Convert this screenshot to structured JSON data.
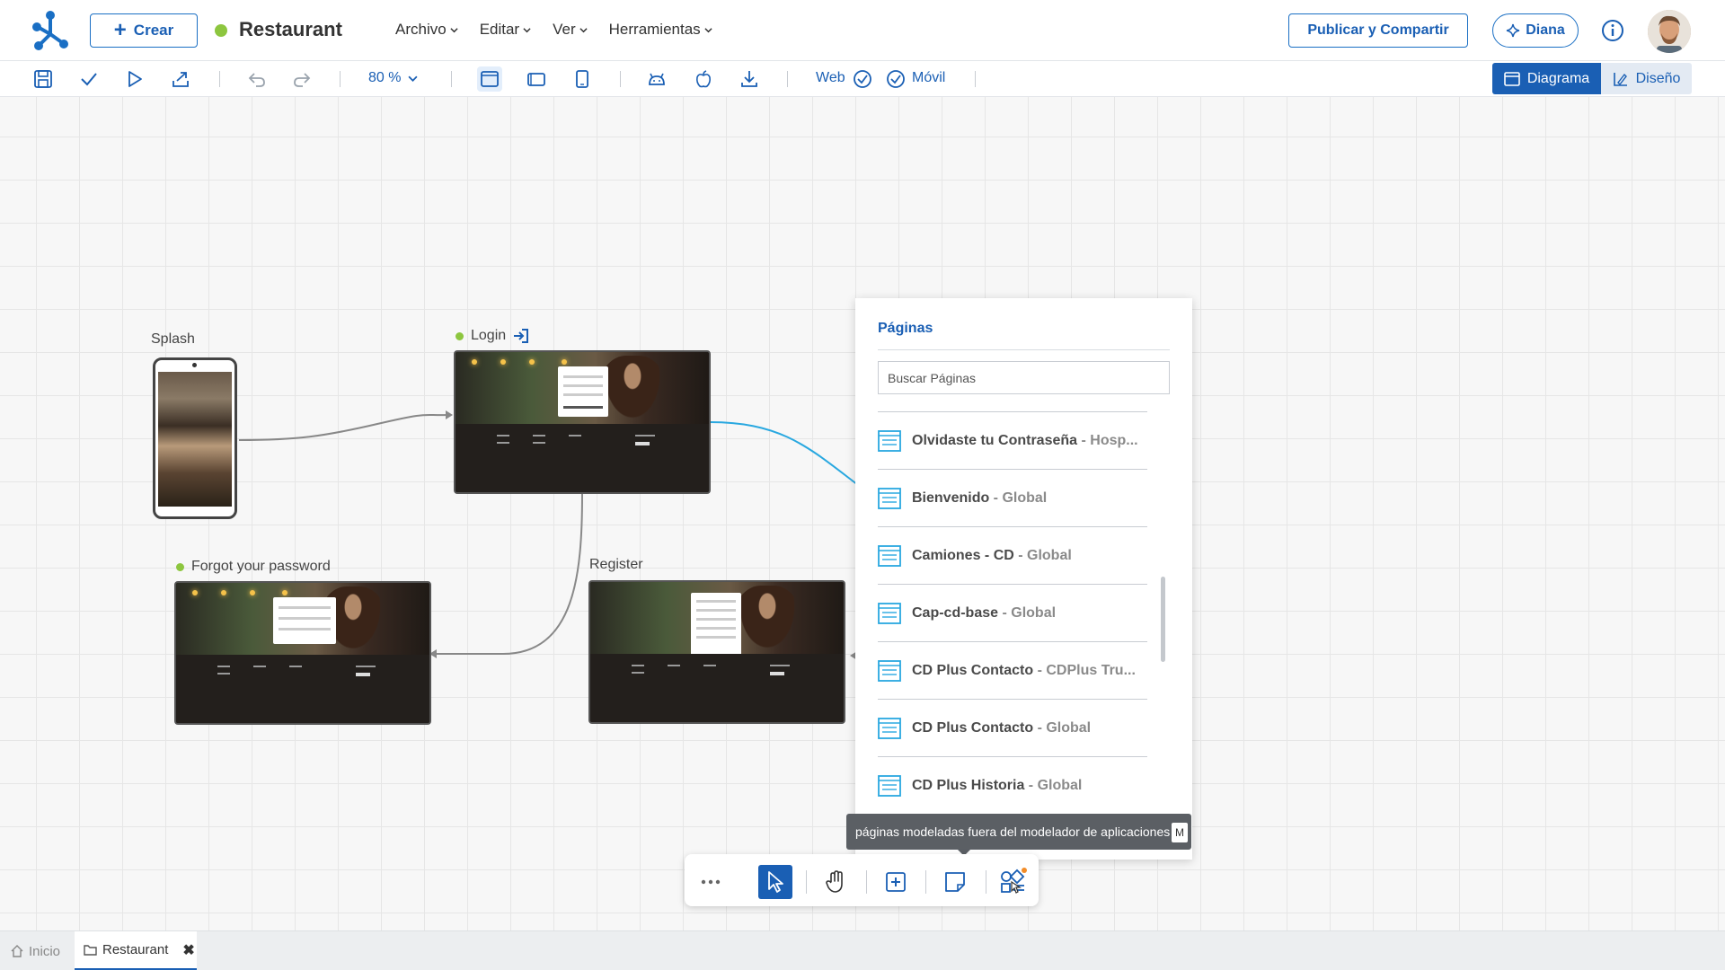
{
  "header": {
    "create_label": "Crear",
    "app_title": "Restaurant",
    "menu": [
      "Archivo",
      "Editar",
      "Ver",
      "Herramientas"
    ],
    "publish_label": "Publicar y Compartir",
    "assistant_label": "Diana"
  },
  "toolbar": {
    "zoom": "80 %",
    "web_label": "Web",
    "movil_label": "Móvil",
    "view_diagram": "Diagrama",
    "view_design": "Diseño"
  },
  "canvas": {
    "nodes": {
      "splash": "Splash",
      "login": "Login",
      "forgot": "Forgot your password",
      "register": "Register"
    }
  },
  "pages_panel": {
    "title": "Páginas",
    "search_placeholder": "Buscar Páginas",
    "items": [
      {
        "name": "Olvidaste tu Contraseña",
        "scope": " - Hosp..."
      },
      {
        "name": "Bienvenido",
        "scope": " - Global"
      },
      {
        "name": "Camiones - CD",
        "scope": " - Global"
      },
      {
        "name": "Cap-cd-base",
        "scope": " - Global"
      },
      {
        "name": "CD Plus Contacto",
        "scope": " - CDPlus Tru..."
      },
      {
        "name": "CD Plus Contacto",
        "scope": " - Global"
      },
      {
        "name": "CD Plus Historia",
        "scope": " - Global"
      }
    ]
  },
  "tooltip": {
    "text": "páginas modeladas fuera del modelador de aplicaciones",
    "key": "M"
  },
  "tabs": {
    "home": "Inicio",
    "active": "Restaurant"
  },
  "colors": {
    "accent": "#1a5fb4",
    "status_green": "#8dc63f",
    "connector_blue": "#29a8e0"
  }
}
